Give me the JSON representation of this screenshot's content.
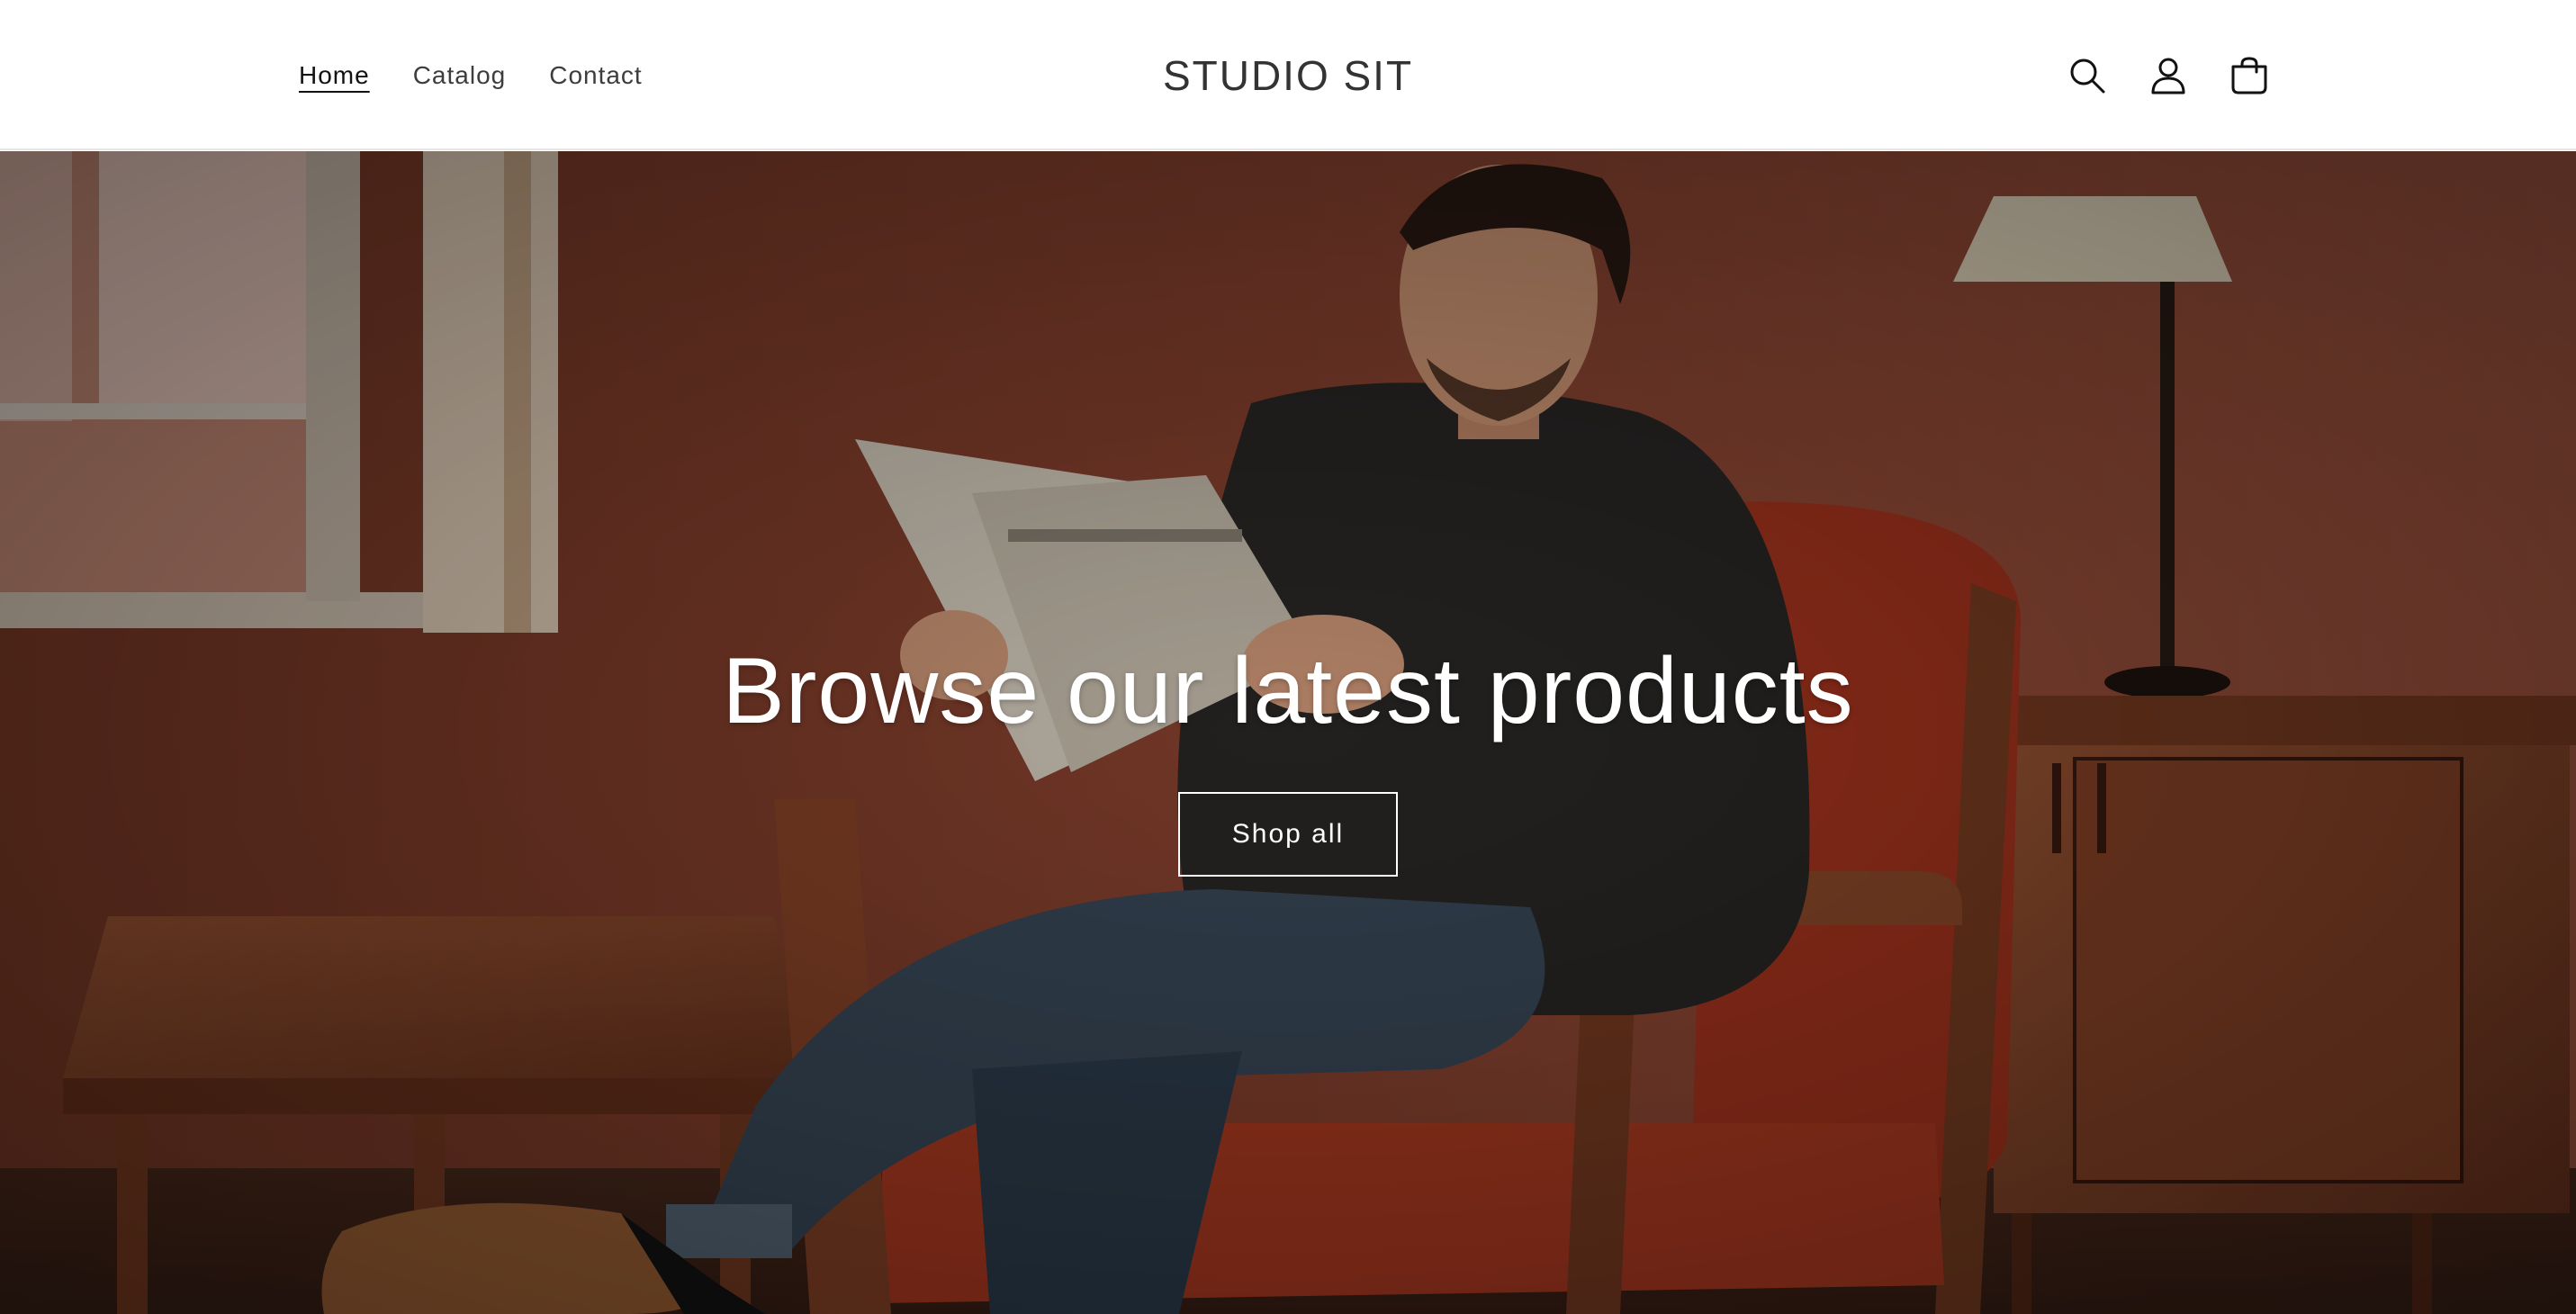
{
  "header": {
    "nav": [
      {
        "label": "Home",
        "active": true
      },
      {
        "label": "Catalog",
        "active": false
      },
      {
        "label": "Contact",
        "active": false
      }
    ],
    "logo": "STUDIO SIT",
    "icons": [
      "search-icon",
      "account-icon",
      "cart-icon"
    ]
  },
  "hero": {
    "title": "Browse our latest products",
    "button_label": "Shop all",
    "image": "hero-image"
  },
  "colors": {
    "header_bg": "#ffffff",
    "nav_text": "#3d3d3d",
    "hero_text": "#ffffff",
    "wall": "#8a4632",
    "chair": "#a8351e",
    "wood": "#8b4a2a"
  }
}
